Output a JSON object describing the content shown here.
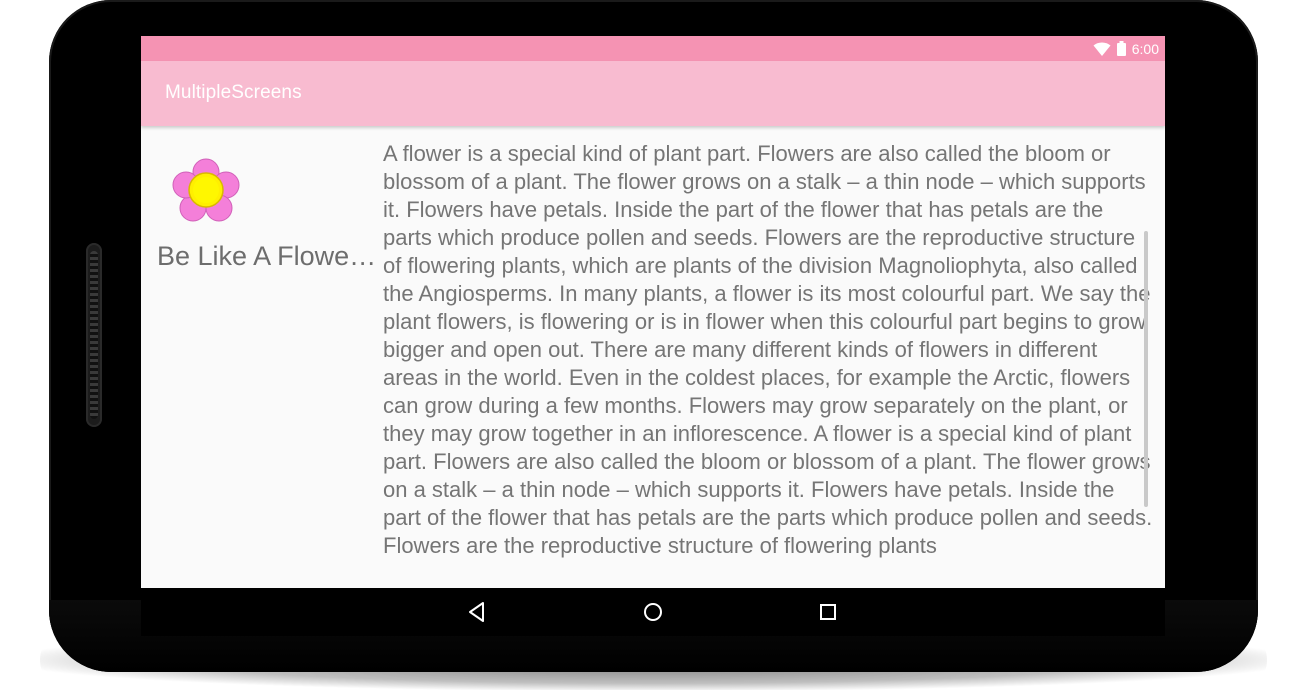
{
  "status_bar": {
    "time": "6:00",
    "wifi_icon": "wifi-icon",
    "battery_icon": "battery-icon",
    "color": "#f593b3"
  },
  "app_bar": {
    "title": "MultipleScreens",
    "color": "#f8bbd0"
  },
  "content": {
    "image_icon": "flower-icon",
    "caption": "Be Like A Flower ...",
    "body": "A flower is a special kind of plant part. Flowers are also called the bloom or blossom of a plant. The flower grows on a stalk – a thin node – which supports it. Flowers have petals. Inside the part of the flower that has petals are the parts which produce pollen and seeds. Flowers are the reproductive structure of flowering plants, which are plants of the division Magnoliophyta, also called the Angiosperms. In many plants, a flower is its most colourful part. We say the plant flowers, is flowering or is in flower when this colourful part begins to grow bigger and open out. There are many different kinds of flowers in different areas in the world. Even in the coldest places, for example the Arctic, flowers can grow during a few months. Flowers may grow separately on the plant, or they may grow together in an inflorescence. A flower is a special kind of plant part. Flowers are also called the bloom or blossom of a plant. The flower grows on a stalk – a thin node – which supports it. Flowers have petals. Inside the part of the flower that has petals are the parts which produce pollen and seeds. Flowers are the reproductive structure of flowering plants"
  },
  "nav_bar": {
    "back_icon": "back-icon",
    "home_icon": "home-icon",
    "recents_icon": "recents-icon"
  }
}
